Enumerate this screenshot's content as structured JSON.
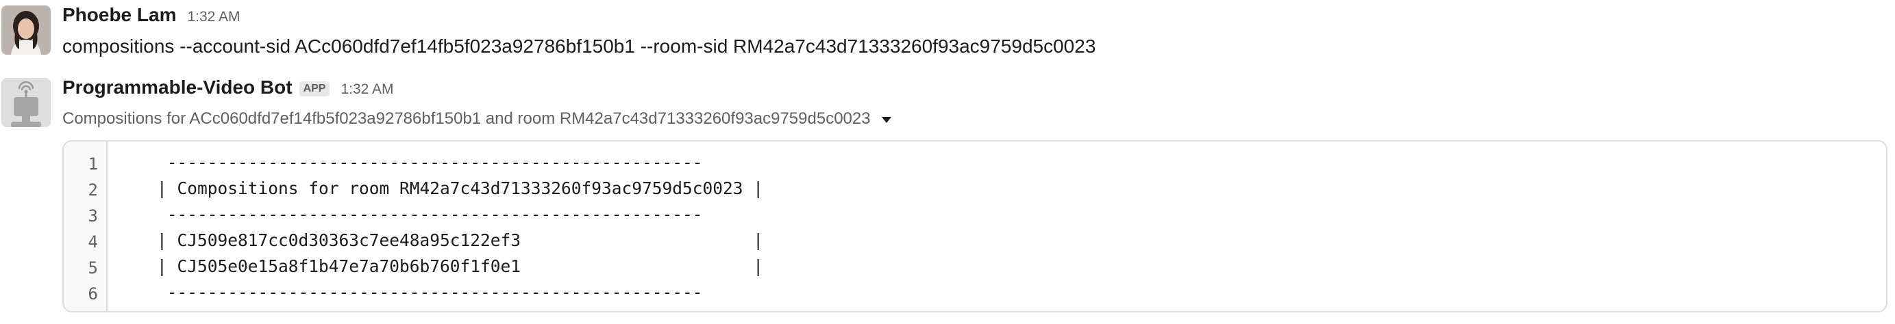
{
  "messages": [
    {
      "sender": "Phoebe Lam",
      "time": "1:32 AM",
      "avatar": "user-photo-avatar",
      "text": "compositions --account-sid ACc060dfd7ef14fb5f023a92786bf150b1 --room-sid RM42a7c43d71333260f93ac9759d5c0023"
    },
    {
      "sender": "Programmable-Video Bot",
      "badge": "APP",
      "time": "1:32 AM",
      "avatar": "bot-avatar",
      "summary": "Compositions for ACc060dfd7ef14fb5f023a92786bf150b1 and room RM42a7c43d71333260f93ac9759d5c0023",
      "expand_icon": "caret-down-icon",
      "code": {
        "line_numbers": [
          "1",
          "2",
          "3",
          "4",
          "5",
          "6"
        ],
        "lines": [
          " -----------------------------------------------------",
          "| Compositions for room RM42a7c43d71333260f93ac9759d5c0023 |",
          " -----------------------------------------------------",
          "| CJ509e817cc0d30363c7ee48a95c122ef3                       |",
          "| CJ505e0e15a8f1b47e7a70b6b760f1f0e1                       |",
          " -----------------------------------------------------"
        ]
      }
    }
  ],
  "colors": {
    "text": "#1d1c1d",
    "muted": "#616061",
    "border": "#dddddd",
    "gutter_bg": "#f8f8f8",
    "badge_bg": "#e8e8e8"
  }
}
